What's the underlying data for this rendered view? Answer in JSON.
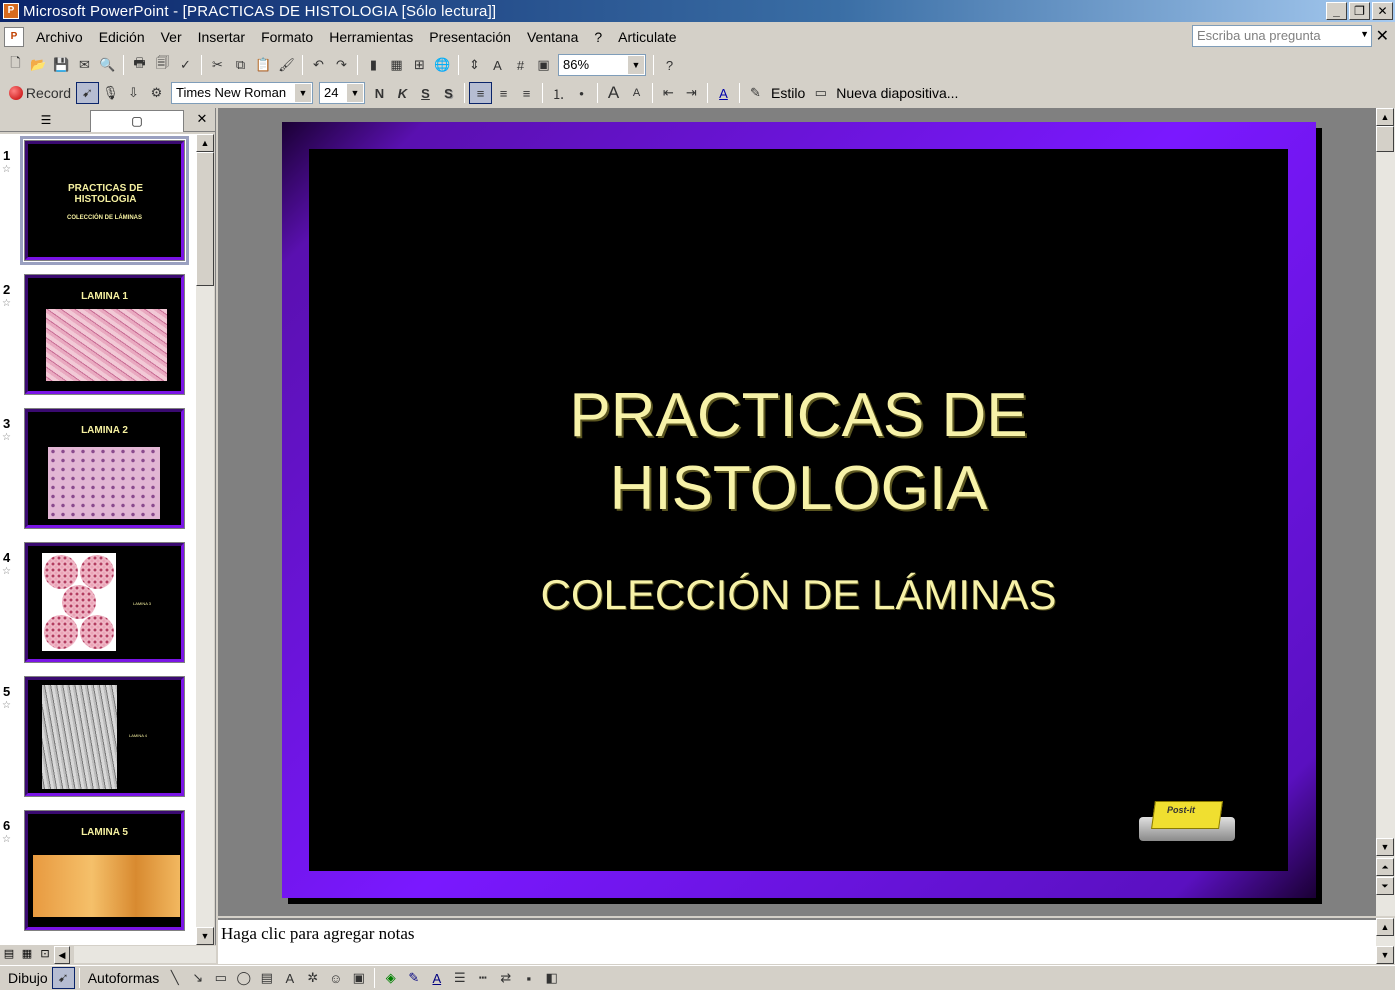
{
  "window": {
    "title": "Microsoft PowerPoint - [PRACTICAS DE HISTOLOGIA [Sólo lectura]]"
  },
  "menubar": {
    "items": [
      "Archivo",
      "Edición",
      "Ver",
      "Insertar",
      "Formato",
      "Herramientas",
      "Presentación",
      "Ventana",
      "?",
      "Articulate"
    ],
    "ask_placeholder": "Escriba una pregunta"
  },
  "toolbar1": {
    "zoom": "86%"
  },
  "toolbar2": {
    "record_label": "Record",
    "font_name": "Times New Roman",
    "font_size": "24",
    "bold": "N",
    "italic": "K",
    "underline": "S",
    "shadow": "S",
    "style_label": "Estilo",
    "new_slide_label": "Nueva diapositiva..."
  },
  "slides_panel": {
    "slides": [
      {
        "number": "1",
        "title": "PRACTICAS DE HISTOLOGIA",
        "subtitle": "COLECCIÓN DE LÁMINAS"
      },
      {
        "number": "2",
        "title": "LAMINA 1"
      },
      {
        "number": "3",
        "title": "LAMINA 2"
      },
      {
        "number": "4",
        "title": "LAMINA 3"
      },
      {
        "number": "5",
        "title": "LAMINA 4"
      },
      {
        "number": "6",
        "title": "LAMINA 5"
      }
    ]
  },
  "slide": {
    "title_line1": "PRACTICAS DE",
    "title_line2": "HISTOLOGIA",
    "subtitle": "COLECCIÓN DE LÁMINAS",
    "postit_label": "Post-it"
  },
  "notes": {
    "placeholder": "Haga clic para agregar notas"
  },
  "drawbar": {
    "draw_label": "Dibujo",
    "autoshapes_label": "Autoformas"
  },
  "colors": {
    "titlebar": "#0a246a",
    "slide_border": "#7a18ff",
    "slide_text": "#f7f2a8"
  }
}
